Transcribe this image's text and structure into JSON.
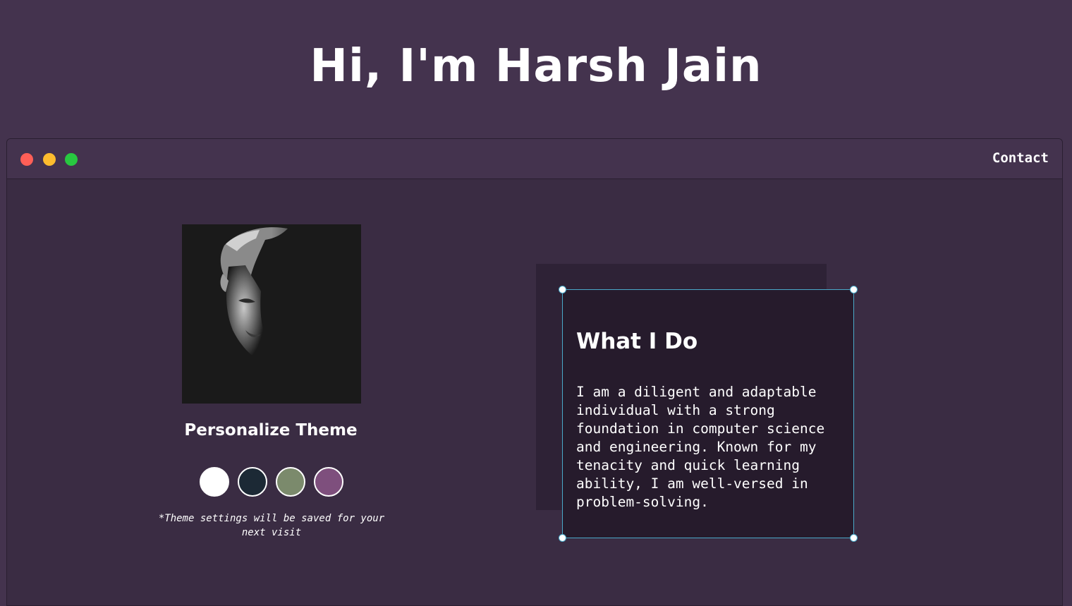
{
  "header": {
    "title": "Hi, I'm Harsh Jain"
  },
  "window": {
    "controls": [
      {
        "name": "close",
        "color": "#ff5f57"
      },
      {
        "name": "minimize",
        "color": "#febc2e"
      },
      {
        "name": "maximize",
        "color": "#28c840"
      }
    ],
    "nav": {
      "contact_label": "Contact"
    }
  },
  "profile": {
    "photo_icon": "portrait-photo"
  },
  "theme": {
    "heading": "Personalize Theme",
    "swatches": [
      {
        "name": "white",
        "color": "#ffffff"
      },
      {
        "name": "dark-navy",
        "color": "#1c2935"
      },
      {
        "name": "sage-green",
        "color": "#7b8a6c"
      },
      {
        "name": "plum",
        "color": "#7e4f7d"
      }
    ],
    "note": "*Theme settings will be saved for your next visit"
  },
  "about": {
    "title": "What I Do",
    "body": "I am a diligent and adaptable individual with a strong foundation in computer science and engineering. Known for my tenacity and quick learning ability, I am well-versed in problem-solving."
  },
  "colors": {
    "page_bg": "#44334e",
    "window_bg": "#3a2c43",
    "card_bg": "#261b2c",
    "selection_border": "#4aa9c9"
  }
}
